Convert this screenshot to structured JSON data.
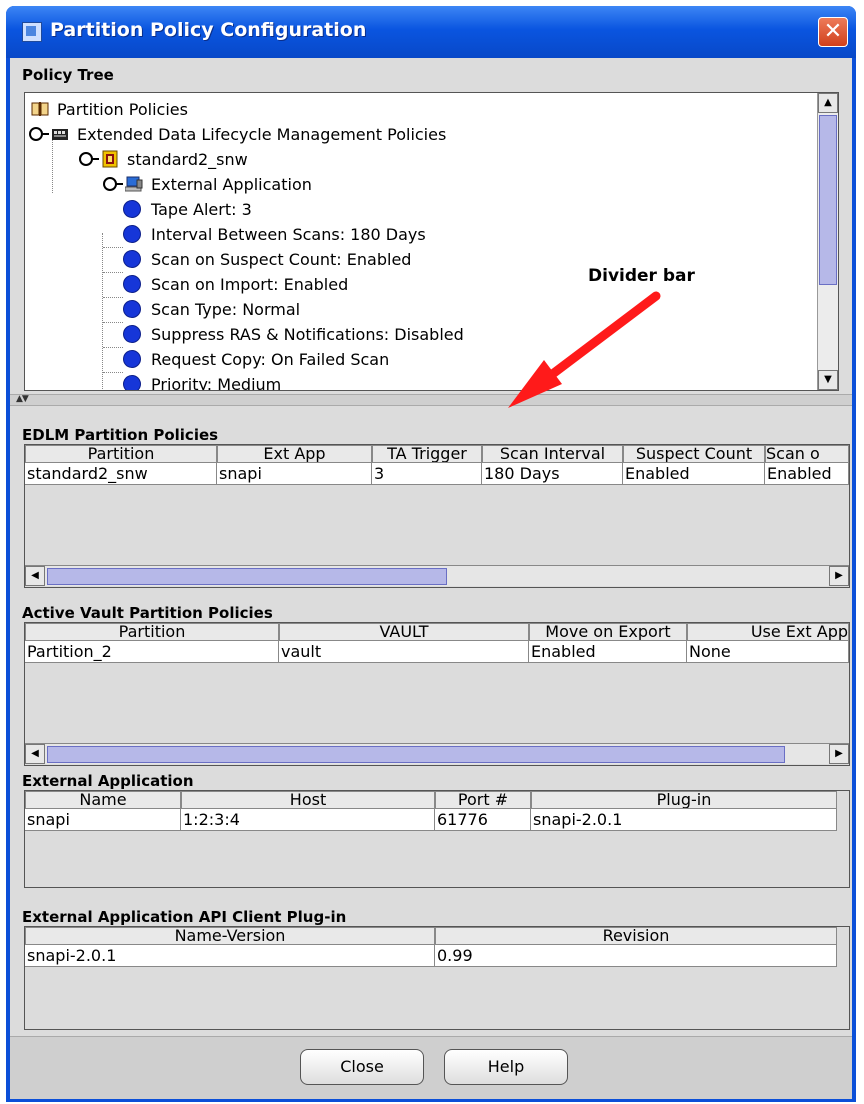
{
  "window": {
    "title": "Partition Policy Configuration",
    "close_glyph": "✕"
  },
  "policy_tree": {
    "title": "Policy Tree",
    "nodes": [
      "Partition Policies",
      "Extended Data Lifecycle Management Policies",
      "standard2_snw",
      "External Application",
      "Tape Alert: 3",
      "Interval Between Scans: 180 Days",
      "Scan on Suspect Count: Enabled",
      "Scan on Import: Enabled",
      "Scan Type: Normal",
      "Suppress RAS & Notifications: Disabled",
      "Request Copy: On Failed Scan",
      "Priority: Medium"
    ]
  },
  "edlm": {
    "title": "EDLM Partition Policies",
    "columns": [
      "Partition",
      "Ext App",
      "TA Trigger",
      "Scan Interval",
      "Suspect Count",
      "Scan o"
    ],
    "rows": [
      [
        "standard2_snw",
        "snapi",
        "3",
        "180 Days",
        "Enabled",
        "Enabled"
      ]
    ]
  },
  "vault": {
    "title": "Active Vault Partition Policies",
    "columns": [
      "Partition",
      "VAULT",
      "Move on Export",
      "Use Ext App"
    ],
    "rows": [
      [
        "Partition_2",
        "vault",
        "Enabled",
        "None"
      ]
    ]
  },
  "ext_app": {
    "title": "External Application",
    "columns": [
      "Name",
      "Host",
      "Port #",
      "Plug-in"
    ],
    "rows": [
      [
        "snapi",
        "1:2:3:4",
        "61776",
        "snapi-2.0.1"
      ]
    ]
  },
  "plugin": {
    "title": "External Application API Client Plug-in",
    "columns": [
      "Name-Version",
      "Revision"
    ],
    "rows": [
      [
        "snapi-2.0.1",
        "0.99"
      ]
    ]
  },
  "buttons": {
    "close": "Close",
    "help": "Help"
  },
  "annotation": {
    "label": "Divider bar",
    "color": "#ff1a1a"
  },
  "colors": {
    "titlebar": "#0a55e0",
    "tree_node": "#1636d8",
    "scroll_thumb": "#b6b8e8"
  }
}
